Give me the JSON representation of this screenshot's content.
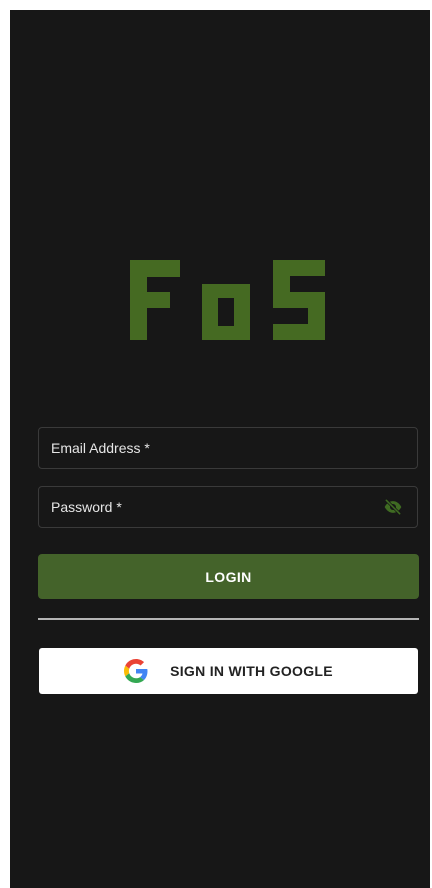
{
  "app": {
    "logo_text": "FoS"
  },
  "form": {
    "email_label": "Email Address *",
    "password_label": "Password *",
    "login_label": "LOGIN",
    "google_label": "SIGN IN WITH GOOGLE"
  },
  "icons": {
    "password_toggle": "eye-off-icon",
    "google": "google-g-icon"
  },
  "colors": {
    "background": "#171717",
    "accent": "#44632a",
    "logo": "#456a22",
    "eye_icon": "#3f6b22"
  }
}
